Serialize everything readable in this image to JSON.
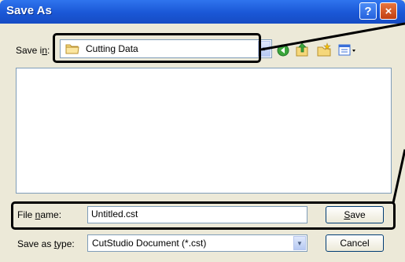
{
  "window": {
    "title": "Save As"
  },
  "titlebar_buttons": {
    "help": "?",
    "close": "×"
  },
  "toolbar": {
    "save_in_label": "Save in:",
    "save_in_value": "Cutting Data",
    "icons": [
      "folder-icon",
      "back-icon",
      "up-folder-icon",
      "new-folder-icon",
      "views-menu-icon"
    ]
  },
  "form": {
    "file_name_label": "File name:",
    "file_name_value": "Untitled.cst",
    "save_as_type_label": "Save as type:",
    "save_as_type_value": "CutStudio Document (*.cst)",
    "save_button": "Save",
    "cancel_button": "Cancel"
  },
  "colors": {
    "titlebar": "#1a57d6",
    "dialog_bg": "#ece9d8",
    "callout": "#000000"
  }
}
